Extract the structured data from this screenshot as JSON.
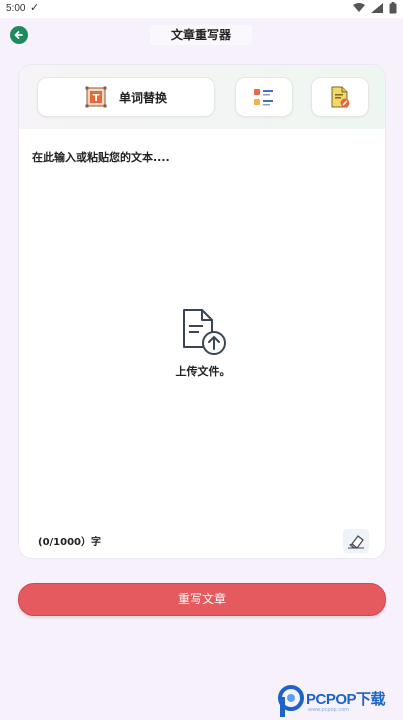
{
  "status_bar": {
    "time": "5:00",
    "check_glyph": "✓",
    "icons": [
      "wifi-icon",
      "signal-icon",
      "battery-icon"
    ]
  },
  "header": {
    "title": "文章重写器",
    "back_icon": "arrow-left-circle-icon"
  },
  "toolbar": {
    "replace_label": "单词替换",
    "replace_icon": "text-frame-icon",
    "list_icon": "checklist-icon",
    "doc_icon": "document-edit-icon"
  },
  "editor": {
    "placeholder": "在此输入或粘贴您的文本....",
    "upload_label": "上传文件。",
    "upload_icon": "file-upload-icon",
    "char_count": "(0/1000）字",
    "eraser_icon": "eraser-icon"
  },
  "actions": {
    "rewrite_label": "重写文章"
  },
  "watermark": {
    "text": "PCPOP下载",
    "sub": "www.pcpop.com"
  },
  "colors": {
    "accent_green": "#1f8a5e",
    "rewrite_red": "#e45a5f",
    "background": "#f7f1fb",
    "watermark_blue": "#1c64c8"
  }
}
